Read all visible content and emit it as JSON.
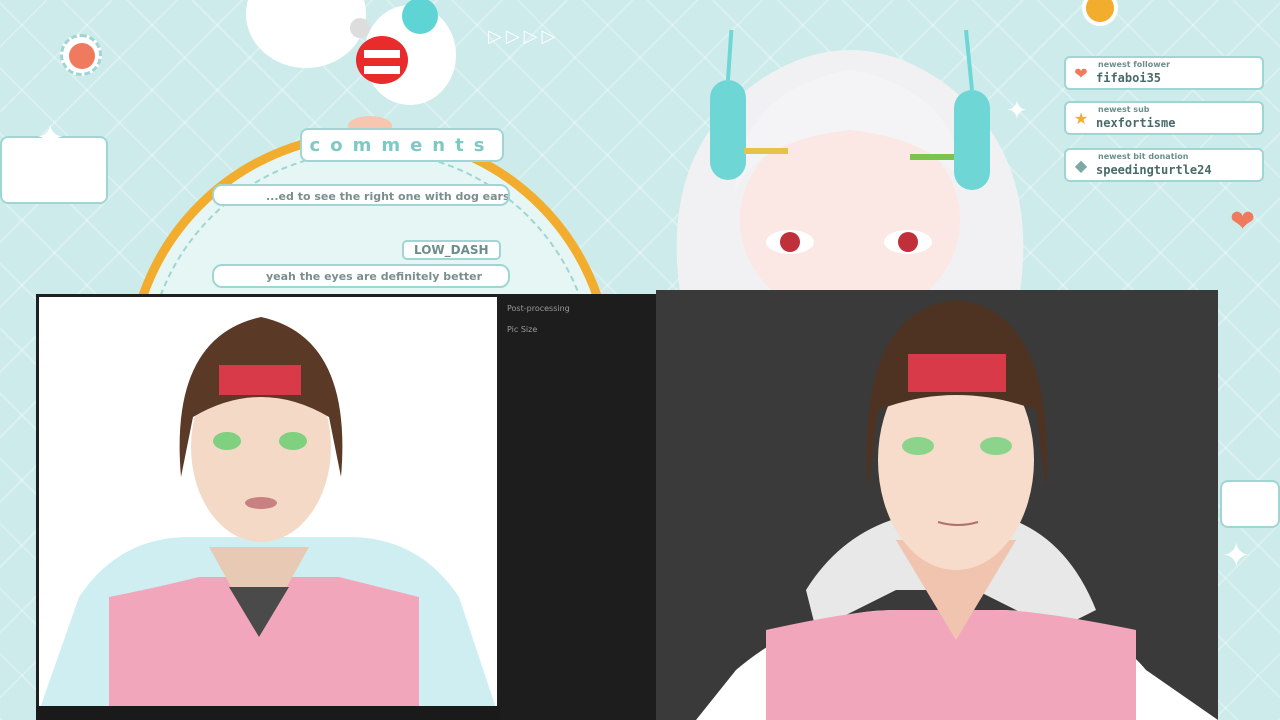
{
  "overlay": {
    "comments_title": "comments",
    "comments": [
      {
        "text": "...ed to see the right one with dog ears"
      },
      {
        "author": "LOW_DASH",
        "text": "yeah the eyes are definitely better"
      }
    ],
    "alerts": [
      {
        "label": "newest follower",
        "value": "fifaboi35",
        "icon": "heart-icon"
      },
      {
        "label": "newest sub",
        "value": "nexfortisme",
        "icon": "star-icon"
      },
      {
        "label": "newest bit donation",
        "value": "speedingturtle24",
        "icon": "gem-icon"
      }
    ]
  },
  "app": {
    "settings": {
      "post_processing_label": "Post-processing",
      "pic_size_label": "Pic Size"
    }
  },
  "colors": {
    "background": "#cdebea",
    "accent_orange": "#f2ad2e",
    "accent_teal": "#9fd6d3",
    "hoodie_pink": "#f2a6bb",
    "headband_red": "#d93a4a"
  }
}
